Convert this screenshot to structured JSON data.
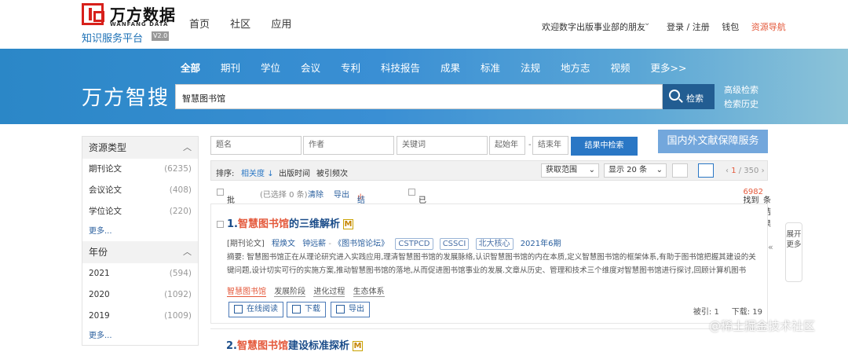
{
  "header": {
    "logo_name": "万方数据",
    "logo_en": "WANFANG DATA",
    "logo_sub": "知识服务平台",
    "logo_version": "V2.0",
    "nav": [
      "首页",
      "社区",
      "应用"
    ],
    "welcome": "欢迎数字出版事业部的朋友",
    "login": "登录 / 注册",
    "wallet": "钱包",
    "resource_nav": "资源导航"
  },
  "banner": {
    "title": "万方智搜",
    "categories": [
      "全部",
      "期刊",
      "学位",
      "会议",
      "专利",
      "科技报告",
      "成果",
      "标准",
      "法规",
      "地方志",
      "视频",
      "更多>>"
    ],
    "search_value": "智慧图书馆",
    "search_button": "检索",
    "advanced": "高级检索",
    "history": "检索历史"
  },
  "left": {
    "section1": {
      "title": "资源类型",
      "items": [
        {
          "label": "期刊论文",
          "count": "(6235)"
        },
        {
          "label": "会议论文",
          "count": "(408)"
        },
        {
          "label": "学位论文",
          "count": "(220)"
        }
      ],
      "more": "更多..."
    },
    "section2": {
      "title": "年份",
      "items": [
        {
          "label": "2021",
          "count": "(594)"
        },
        {
          "label": "2020",
          "count": "(1092)"
        },
        {
          "label": "2019",
          "count": "(1009)"
        }
      ],
      "more": "更多..."
    }
  },
  "filters": {
    "title_ph": "题名",
    "author_ph": "作者",
    "keyword_ph": "关键词",
    "start_year_ph": "起始年",
    "end_year_ph": "结束年",
    "search_in_results": "结果中检索",
    "service": "国内外文献保障服务"
  },
  "sortbar": {
    "label": "排序:",
    "relevance": "相关度",
    "pub_time": "出版时间",
    "cited": "被引频次",
    "scope": "获取范围",
    "show": "显示 20 条",
    "page_current": "1",
    "page_total": "/ 350"
  },
  "actions": {
    "batch": "批量选择",
    "selected": "(已选择 0 条)",
    "clear": "清除",
    "export": "导出",
    "analysis": "结果分析",
    "fulltext": "已购全文",
    "found_prefix": "找到",
    "found_count": "6982",
    "found_suffix": "条结果"
  },
  "result1": {
    "index": "1.",
    "title_hl": "智慧图书馆",
    "title_rest": "的三维解析",
    "badge": "M",
    "type": "[期刊论文]",
    "author1": "程焕文",
    "author2": "钟远薪",
    "journal": "《图书馆论坛》",
    "tags": [
      "CSTPCD",
      "CSSCI",
      "北大核心"
    ],
    "date": "2021年6期",
    "abstract": "摘要: 智慧图书馆正在从理论研究进入实践应用,理清智慧图书馆的发展脉络,认识智慧图书馆的内在本质,定义智慧图书馆的框架体系,有助于图书馆把握其建设的关键问题,设计切实可行的实施方案,推动智慧图书馆的落地,从而促进图书馆事业的发展.文章从历史、管理和技术三个维度对智慧图书馆进行探讨,回顾计算机图书馆、网络图书馆、数字图...",
    "keywords": [
      "智慧图书馆",
      "发展阶段",
      "进化过程",
      "生态体系"
    ],
    "btn_read": "在线阅读",
    "btn_download": "下载",
    "btn_export": "导出",
    "cited": "被引: 1",
    "downloads": "下载: 19"
  },
  "result2": {
    "index": "2.",
    "title_hl": "智慧图书馆",
    "title_rest": "建设标准探析",
    "badge": "M"
  },
  "sidetab": "展开更多",
  "watermark": "@稀土掘金技术社区"
}
